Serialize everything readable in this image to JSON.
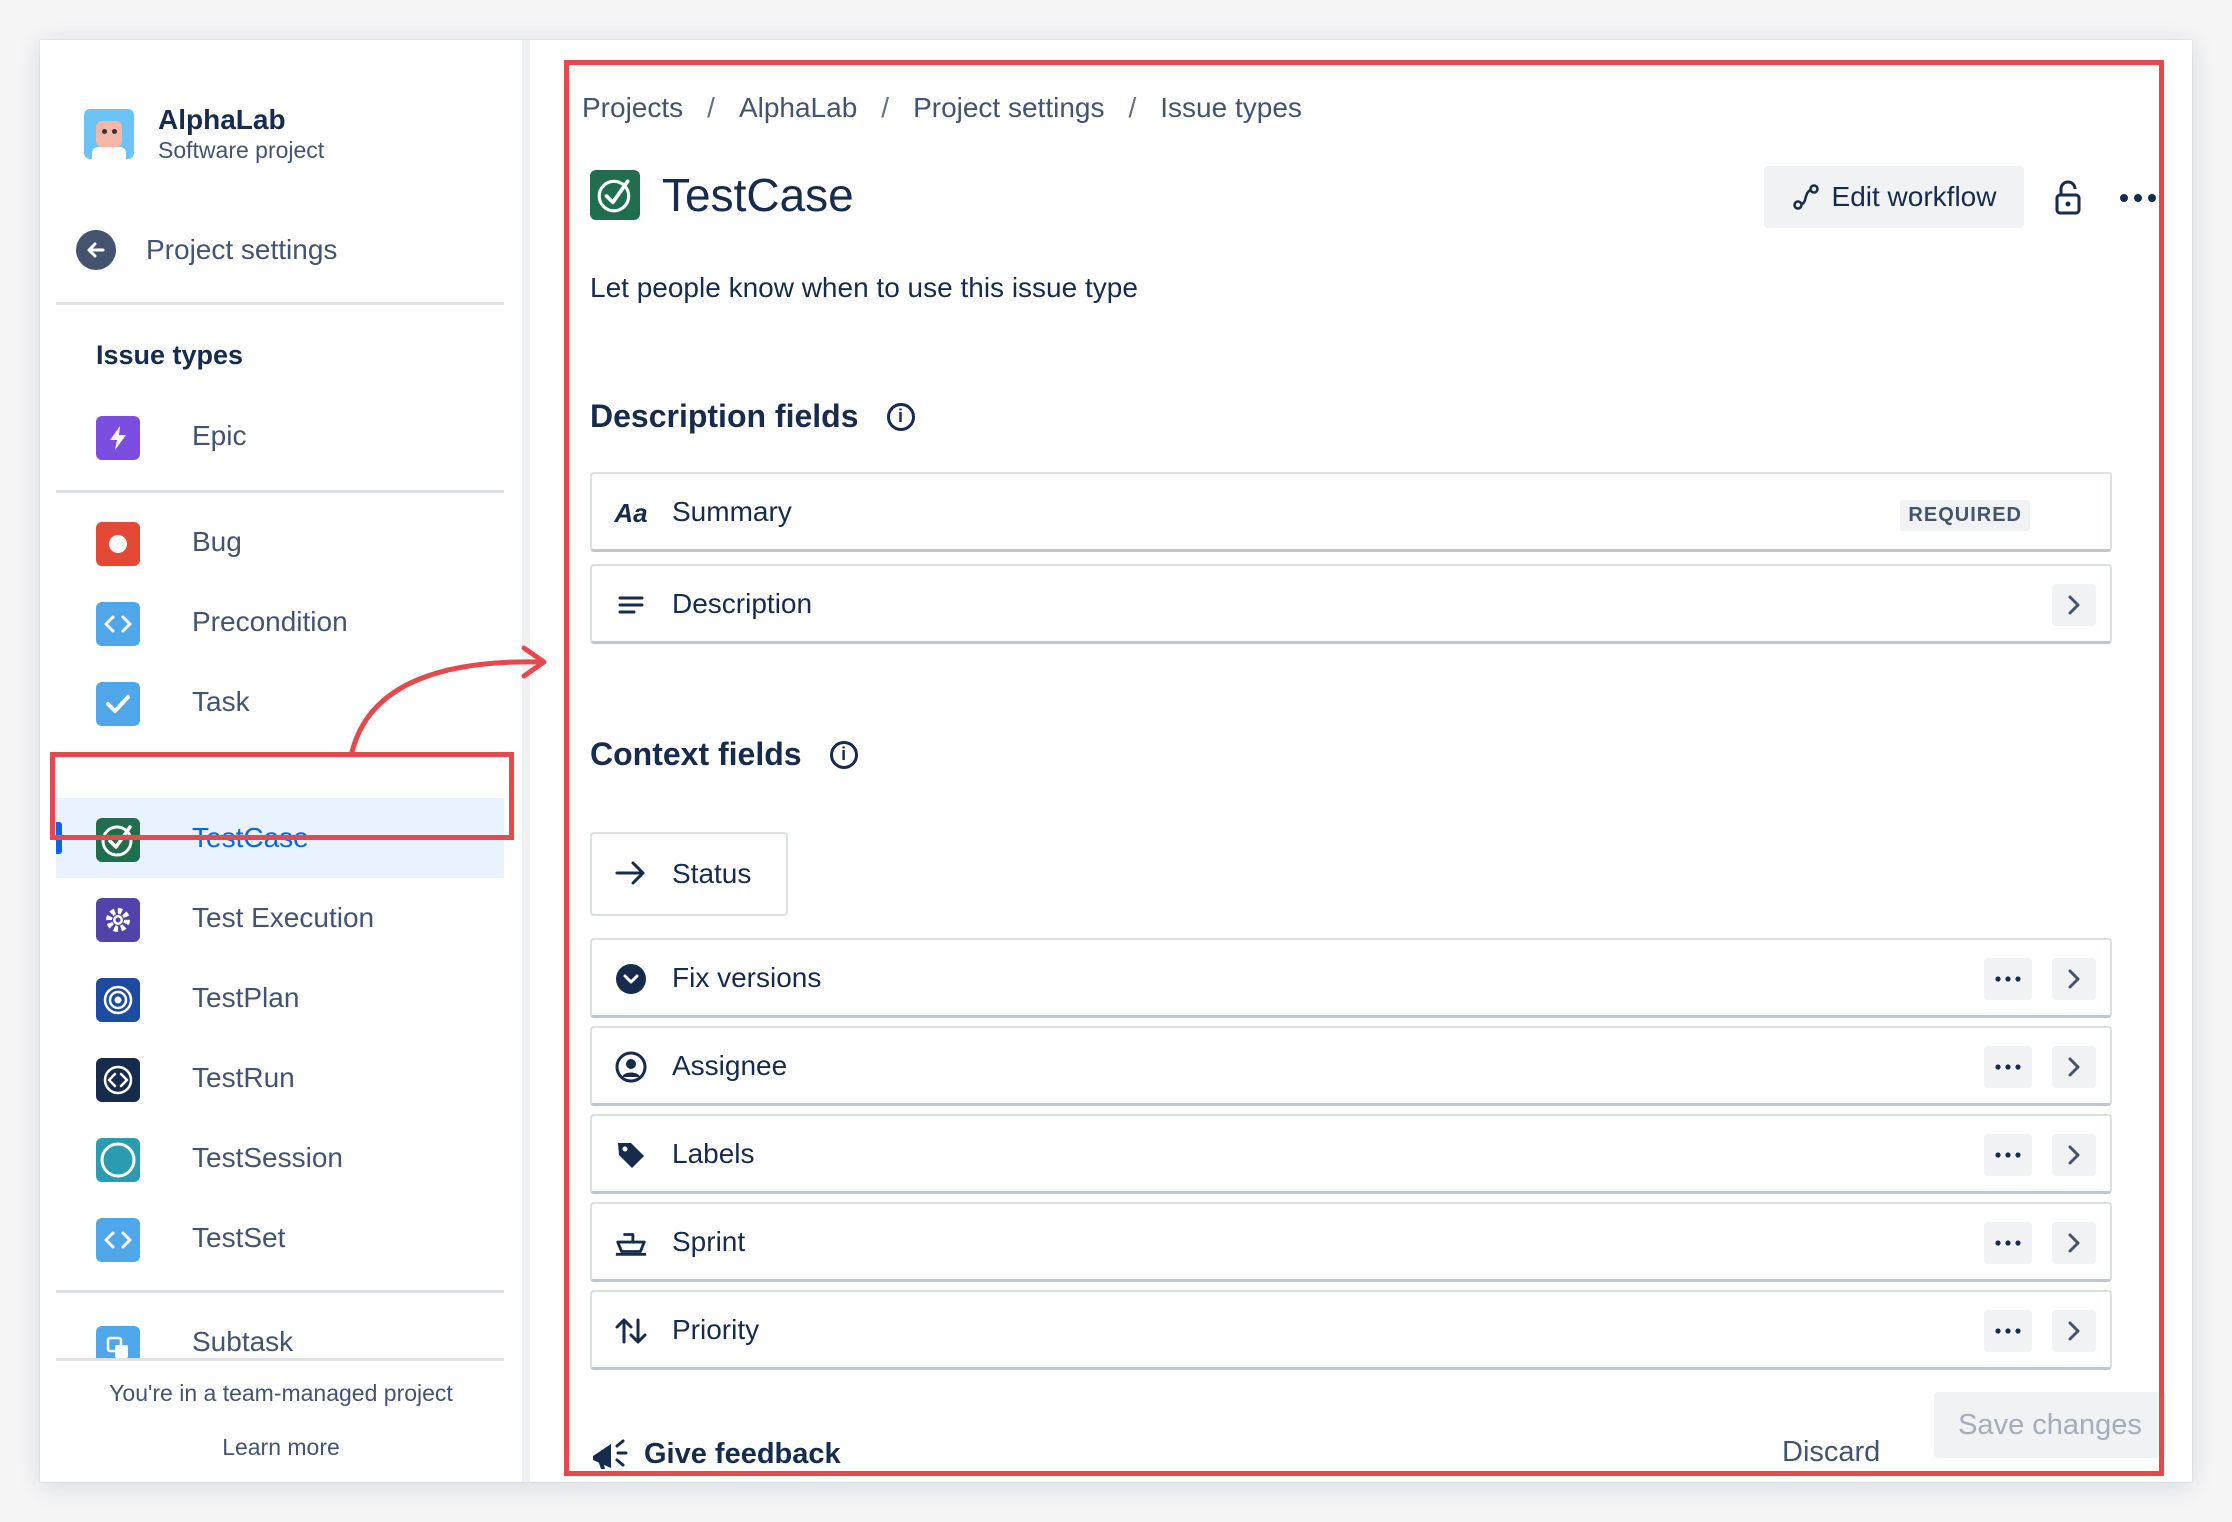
{
  "project": {
    "name": "AlphaLab",
    "type": "Software project"
  },
  "sidebar": {
    "back_label": "Project settings",
    "section_title": "Issue types",
    "items": [
      {
        "label": "Epic",
        "icon": "epic-icon",
        "color": "#7b4ee0"
      },
      {
        "label": "Bug",
        "icon": "bug-icon",
        "color": "#e34935"
      },
      {
        "label": "Precondition",
        "icon": "code-icon",
        "color": "#4fa6e8"
      },
      {
        "label": "Task",
        "icon": "checkbox-icon",
        "color": "#4fa6e8"
      },
      {
        "label": "TestCase",
        "icon": "testcase-icon",
        "color": "#216e4e"
      },
      {
        "label": "Test Execution",
        "icon": "gear-icon",
        "color": "#5243aa"
      },
      {
        "label": "TestPlan",
        "icon": "target-icon",
        "color": "#1d4ba0"
      },
      {
        "label": "TestRun",
        "icon": "diamond-code-icon",
        "color": "#172b4d"
      },
      {
        "label": "TestSession",
        "icon": "circle-icon",
        "color": "#2a9bb0"
      },
      {
        "label": "TestSet",
        "icon": "code-icon",
        "color": "#4fa6e8"
      },
      {
        "label": "Subtask",
        "icon": "subtask-icon",
        "color": "#4fa6e8"
      }
    ],
    "team_text": "You're in a team-managed project",
    "learn_more": "Learn more"
  },
  "breadcrumb": [
    "Projects",
    "AlphaLab",
    "Project settings",
    "Issue types"
  ],
  "header": {
    "title": "TestCase",
    "edit_workflow": "Edit workflow",
    "subtitle": "Let people know when to use this issue type"
  },
  "description_fields": {
    "title": "Description fields",
    "rows": [
      {
        "label": "Summary",
        "icon": "text-aa-icon",
        "badge": "REQUIRED"
      },
      {
        "label": "Description",
        "icon": "lines-icon"
      }
    ]
  },
  "context_fields": {
    "title": "Context fields",
    "status_label": "Status",
    "rows": [
      {
        "label": "Fix versions",
        "icon": "version-icon"
      },
      {
        "label": "Assignee",
        "icon": "person-icon"
      },
      {
        "label": "Labels",
        "icon": "tag-icon"
      },
      {
        "label": "Sprint",
        "icon": "sprint-icon"
      },
      {
        "label": "Priority",
        "icon": "priority-icon"
      }
    ]
  },
  "footer": {
    "feedback": "Give feedback",
    "discard": "Discard",
    "save": "Save changes"
  },
  "colors": {
    "accent": "#0c66e4",
    "highlight": "#e5484d",
    "text": "#172b4d"
  }
}
